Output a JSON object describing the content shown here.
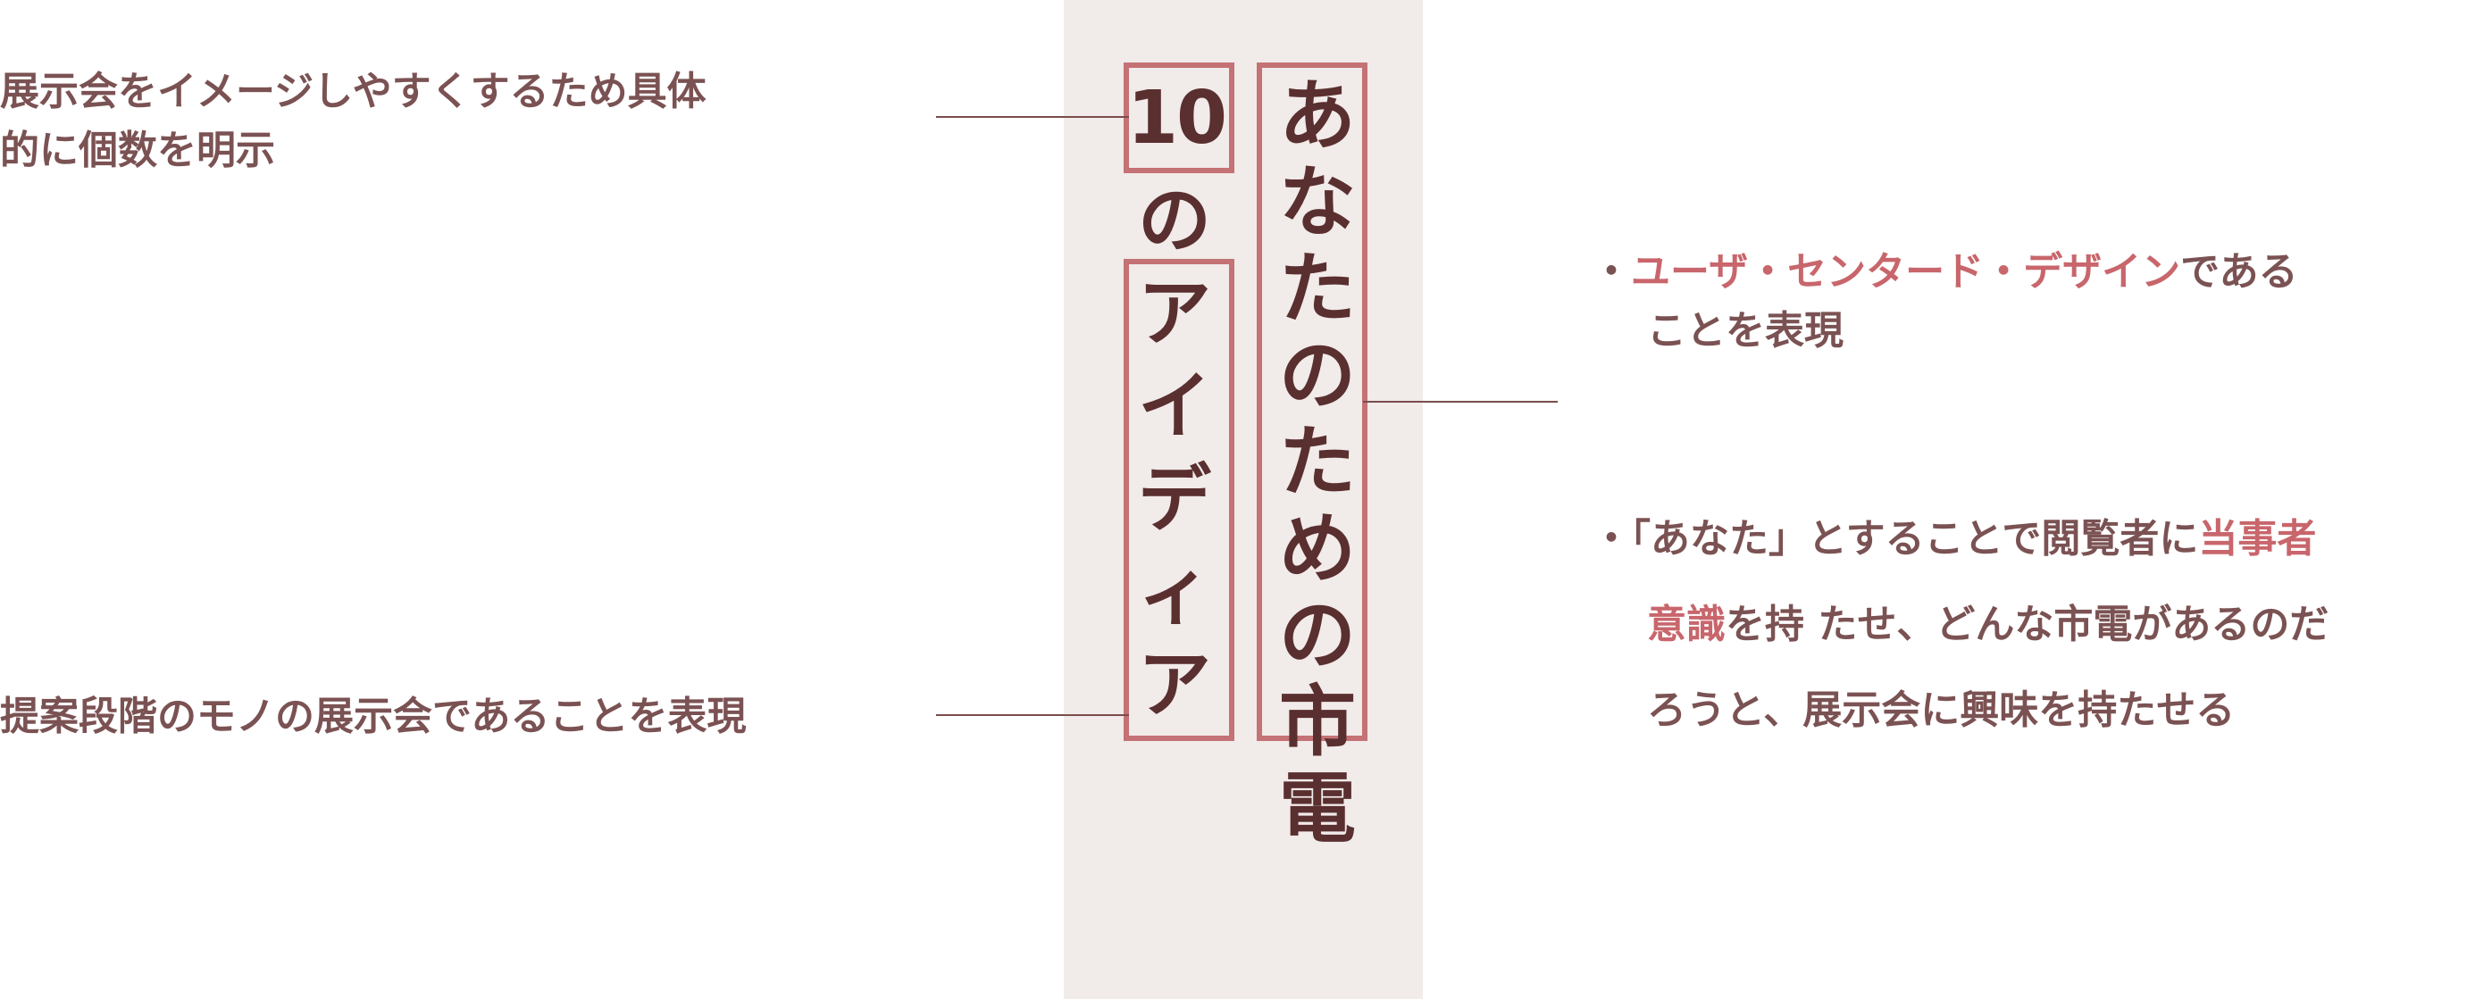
{
  "note_top_left": [
    "展示会をイメージしやすくするため具体",
    "的に個数を明示"
  ],
  "note_bottom_left": "提案段階のモノの展示会であることを表現",
  "title_main": [
    "あ",
    "な",
    "た",
    "の",
    "た",
    "め",
    "の",
    "市",
    "電"
  ],
  "title_number": "10",
  "title_sub": [
    "の",
    "ア",
    "イ",
    "デ",
    "ィ",
    "ア"
  ],
  "bullet1": {
    "mark": "・",
    "highlight": "ユーザ・センタード・デザイン",
    "rest": "である",
    "line2": "ことを表現"
  },
  "bullet2": {
    "mark": "・",
    "pre": "「あなた」とすることで閲覧者に",
    "highlight1": "当事者",
    "highlight2": "意識",
    "mid": "を持 たせ、どんな市電があるのだ",
    "line3": "ろうと、展示会に興味を持たせる"
  },
  "colors": {
    "panel": "#f1ebe9",
    "box": "#c47275",
    "title": "#5a2f30",
    "text": "#7b5253",
    "highlight": "#c8666c"
  }
}
